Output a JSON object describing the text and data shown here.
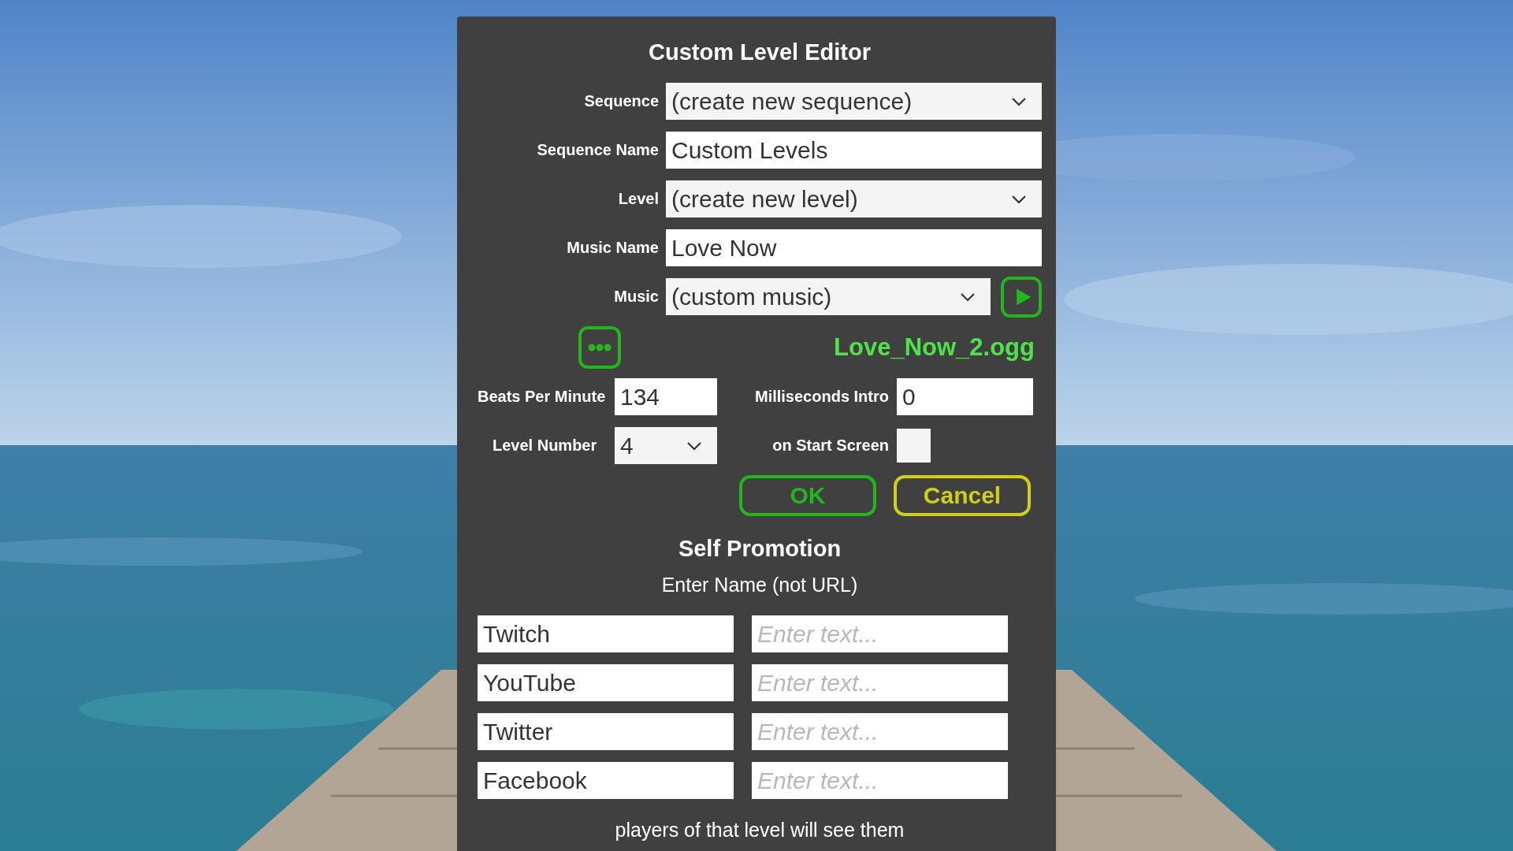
{
  "dialog": {
    "title": "Custom Level Editor",
    "fields": [
      {
        "label": "Sequence",
        "kind": "dropdown",
        "value": "(create new sequence)"
      },
      {
        "label": "Sequence Name",
        "kind": "text",
        "value": "Custom Levels"
      },
      {
        "label": "Level",
        "kind": "dropdown",
        "value": "(create new level)"
      },
      {
        "label": "Music Name",
        "kind": "text",
        "value": "Love Now"
      },
      {
        "label": "Music",
        "kind": "dropdown_play",
        "value": "(custom music)"
      }
    ],
    "music_file": "Love_Now_2.ogg",
    "beats_per_minute": {
      "label": "Beats Per Minute",
      "value": "134"
    },
    "milliseconds_intro": {
      "label": "Milliseconds Intro",
      "value": "0"
    },
    "level_number": {
      "label": "Level Number",
      "value": "4"
    },
    "on_start_screen": {
      "label": "on Start Screen",
      "checked": false
    },
    "buttons": [
      {
        "label": "OK",
        "kind": "ok"
      },
      {
        "label": "Cancel",
        "kind": "cancel"
      }
    ]
  },
  "self_promotion": {
    "title": "Self Promotion",
    "hint": "Enter Name (not URL)",
    "rows": [
      {
        "value": "Twitch",
        "placeholder": "Enter text..."
      },
      {
        "value": "YouTube",
        "placeholder": "Enter text..."
      },
      {
        "value": "Twitter",
        "placeholder": "Enter text..."
      },
      {
        "value": "Facebook",
        "placeholder": "Enter text..."
      }
    ],
    "footer": "players of that level will see them"
  }
}
